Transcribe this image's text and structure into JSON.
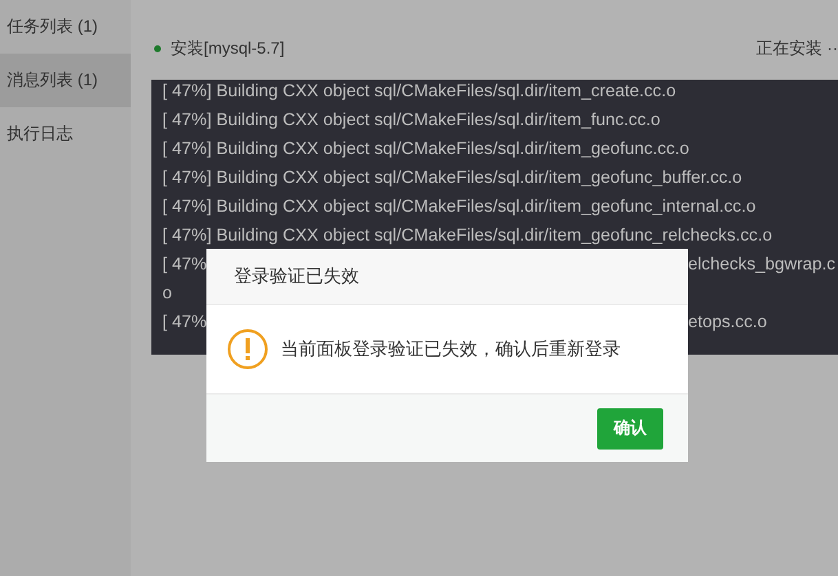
{
  "sidebar": {
    "items": [
      {
        "label": "任务列表 (1)",
        "selected": false
      },
      {
        "label": "消息列表 (1)",
        "selected": true
      },
      {
        "label": "执行日志",
        "selected": false
      }
    ]
  },
  "task": {
    "name": "安装[mysql-5.7]",
    "status": "正在安装 ··"
  },
  "log": {
    "lines": [
      {
        "text": "[ 47%] Building CXX object sql/CMakeFiles/sql.dir/item_create.cc.o"
      },
      {
        "text": "[ 47%] Building CXX object sql/CMakeFiles/sql.dir/item_func.cc.o"
      },
      {
        "text": "[ 47%] Building CXX object sql/CMakeFiles/sql.dir/item_geofunc.cc.o"
      },
      {
        "text": "[ 47%] Building CXX object sql/CMakeFiles/sql.dir/item_geofunc_buffer.cc.o"
      },
      {
        "text": "[ 47%] Building CXX object sql/CMakeFiles/sql.dir/item_geofunc_internal.cc.o"
      },
      {
        "text": "[ 47%] Building CXX object sql/CMakeFiles/sql.dir/item_geofunc_relchecks.cc.o"
      },
      {
        "left": "[ 47%",
        "right": "elchecks_bgwrap.c"
      },
      {
        "text": "o"
      },
      {
        "left": "[ 47%",
        "right": "etops.cc.o"
      }
    ]
  },
  "dialog": {
    "title": "登录验证已失效",
    "message": "当前面板登录验证已失效，确认后重新登录",
    "button": "确认"
  }
}
